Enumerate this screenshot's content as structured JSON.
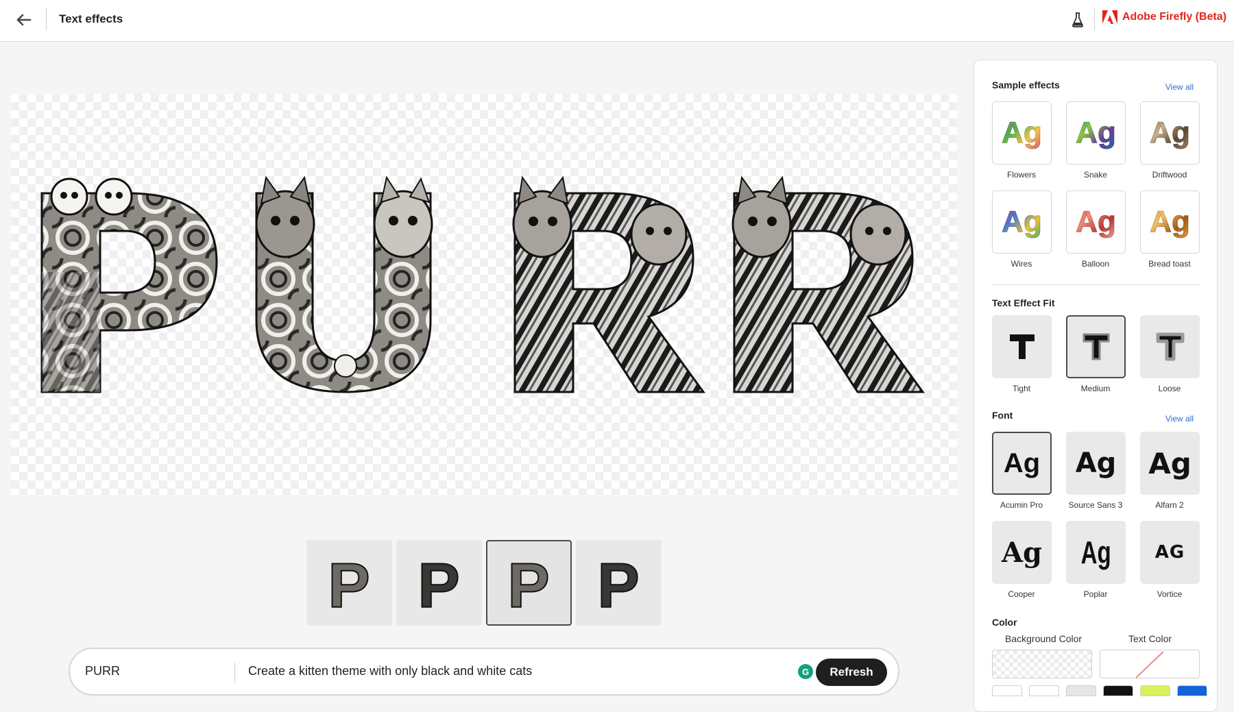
{
  "header": {
    "title": "Text effects",
    "brand": "Adobe Firefly (Beta)",
    "brand_color": "#e1251b",
    "icons": [
      "arrow-left-icon",
      "beaker-icon",
      "adobe-logo-icon"
    ]
  },
  "canvas": {
    "text": "PURR",
    "background": "transparent-checkerboard"
  },
  "variations": {
    "letter": "P",
    "count": 4,
    "selected_index": 2
  },
  "prompt": {
    "text_value": "PURR",
    "prompt_value": "Create a kitten theme with only black and white cats",
    "refresh_label": "Refresh"
  },
  "panel": {
    "sample_effects": {
      "title": "Sample effects",
      "view_all": "View all",
      "items": [
        {
          "label": "Flowers",
          "glyph": "Ag"
        },
        {
          "label": "Snake",
          "glyph": "Ag"
        },
        {
          "label": "Driftwood",
          "glyph": "Ag"
        },
        {
          "label": "Wires",
          "glyph": "Ag"
        },
        {
          "label": "Balloon",
          "glyph": "Ag"
        },
        {
          "label": "Bread toast",
          "glyph": "Ag"
        }
      ]
    },
    "fit": {
      "title": "Text Effect Fit",
      "items": [
        {
          "label": "Tight",
          "glyph": "T"
        },
        {
          "label": "Medium",
          "glyph": "T"
        },
        {
          "label": "Loose",
          "glyph": "T"
        }
      ],
      "selected": "Medium"
    },
    "font": {
      "title": "Font",
      "view_all": "View all",
      "items": [
        {
          "label": "Acumin Pro",
          "glyph": "Ag"
        },
        {
          "label": "Source Sans 3",
          "glyph": "Ag"
        },
        {
          "label": "Alfarn 2",
          "glyph": "Ag"
        },
        {
          "label": "Cooper",
          "glyph": "Ag"
        },
        {
          "label": "Poplar",
          "glyph": "Ag"
        },
        {
          "label": "Vortice",
          "glyph": "AG"
        }
      ],
      "selected": "Acumin Pro"
    },
    "color": {
      "title": "Color",
      "background_label": "Background Color",
      "text_label": "Text Color",
      "swatches": [
        "#ffffff",
        "#ffffff",
        "#e6e6e6",
        "#111111",
        "#d9f25a",
        "#1464d8"
      ]
    }
  }
}
